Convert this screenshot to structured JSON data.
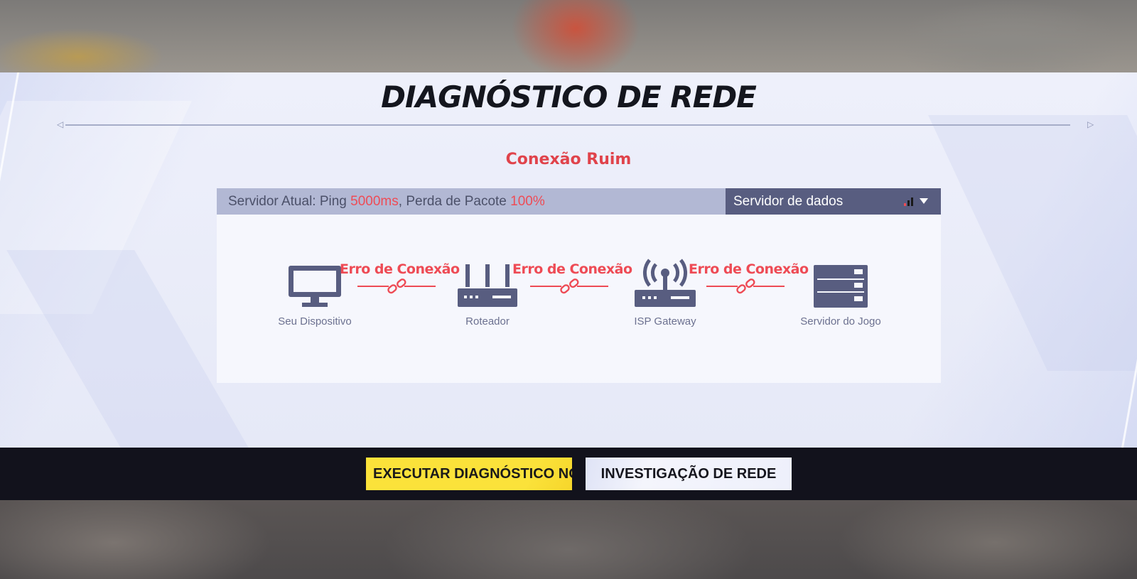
{
  "title": "DIAGNÓSTICO DE REDE",
  "status": "Conexão Ruim",
  "info_bar": {
    "prefix": "Servidor Atual: Ping ",
    "ping": "5000ms",
    "middle": ", Perda de Pacote ",
    "loss": "100%"
  },
  "server_select": {
    "value": "Servidor de dados",
    "signal_icon": "signal-bars-icon",
    "arrow_icon": "dropdown-arrow-icon"
  },
  "nodes": [
    {
      "label": "Seu Dispositivo",
      "icon": "monitor-icon"
    },
    {
      "label": "Roteador",
      "icon": "router-icon"
    },
    {
      "label": "ISP Gateway",
      "icon": "antenna-icon"
    },
    {
      "label": "Servidor do Jogo",
      "icon": "server-icon"
    }
  ],
  "links": [
    {
      "label": "Erro de Conexão",
      "icon": "broken-link-icon"
    },
    {
      "label": "Erro de Conexão",
      "icon": "broken-link-icon"
    },
    {
      "label": "Erro de Conexão",
      "icon": "broken-link-icon"
    }
  ],
  "buttons": {
    "run_again": "EXECUTAR DIAGNÓSTICO NOVAMENTE",
    "investigate": "INVESTIGAÇÃO DE REDE"
  },
  "colors": {
    "accent_red": "#ee4b55",
    "icon_slate": "#585d80",
    "primary_button": "#fbe23a",
    "bottom_bar": "#12121c"
  }
}
